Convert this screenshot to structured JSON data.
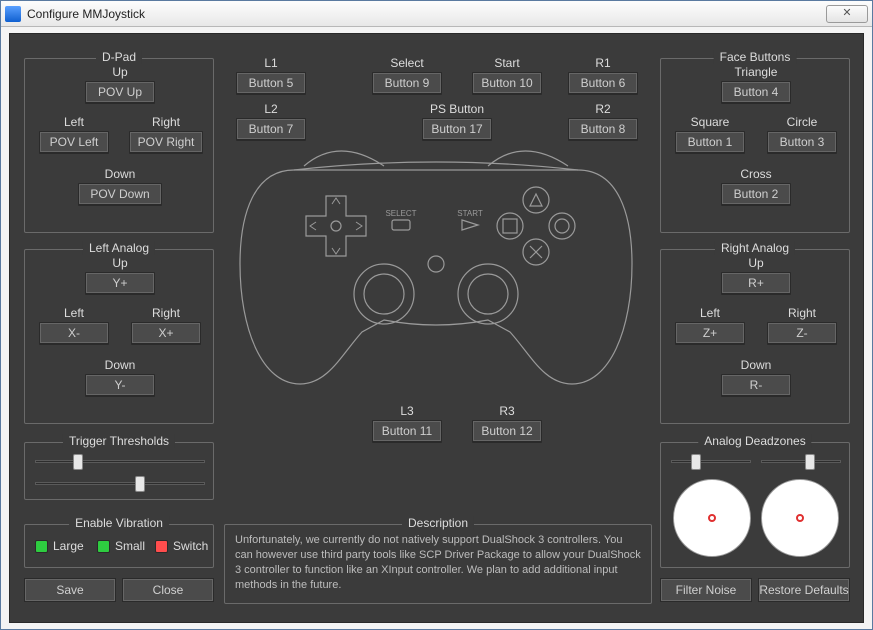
{
  "window": {
    "title": "Configure MMJoystick"
  },
  "top": {
    "l1": {
      "label": "L1",
      "value": "Button 5"
    },
    "l2": {
      "label": "L2",
      "value": "Button 7"
    },
    "select": {
      "label": "Select",
      "value": "Button 9"
    },
    "start": {
      "label": "Start",
      "value": "Button 10"
    },
    "ps": {
      "label": "PS Button",
      "value": "Button 17"
    },
    "r1": {
      "label": "R1",
      "value": "Button 6"
    },
    "r2": {
      "label": "R2",
      "value": "Button 8"
    },
    "l3": {
      "label": "L3",
      "value": "Button 11"
    },
    "r3": {
      "label": "R3",
      "value": "Button 12"
    }
  },
  "dpad": {
    "legend": "D-Pad",
    "up": {
      "label": "Up",
      "value": "POV Up"
    },
    "down": {
      "label": "Down",
      "value": "POV Down"
    },
    "left": {
      "label": "Left",
      "value": "POV Left"
    },
    "right": {
      "label": "Right",
      "value": "POV Right"
    }
  },
  "face": {
    "legend": "Face Buttons",
    "triangle": {
      "label": "Triangle",
      "value": "Button 4"
    },
    "square": {
      "label": "Square",
      "value": "Button 1"
    },
    "circle": {
      "label": "Circle",
      "value": "Button 3"
    },
    "cross": {
      "label": "Cross",
      "value": "Button 2"
    }
  },
  "lanalog": {
    "legend": "Left Analog",
    "up": {
      "label": "Up",
      "value": "Y+"
    },
    "down": {
      "label": "Down",
      "value": "Y-"
    },
    "left": {
      "label": "Left",
      "value": "X-"
    },
    "right": {
      "label": "Right",
      "value": "X+"
    }
  },
  "ranalog": {
    "legend": "Right Analog",
    "up": {
      "label": "Up",
      "value": "R+"
    },
    "down": {
      "label": "Down",
      "value": "R-"
    },
    "left": {
      "label": "Left",
      "value": "Z+"
    },
    "right": {
      "label": "Right",
      "value": "Z-"
    }
  },
  "triggers": {
    "legend": "Trigger Thresholds"
  },
  "deadzones": {
    "legend": "Analog Deadzones"
  },
  "vibration": {
    "legend": "Enable Vibration",
    "large": "Large",
    "small": "Small",
    "switch": "Switch"
  },
  "description": {
    "legend": "Description",
    "text": "Unfortunately, we currently do not natively support DualShock 3 controllers. You can however use third party tools like SCP Driver Package to allow your DualShock 3 controller to function like an XInput controller. We plan to add additional input methods in the future."
  },
  "actions": {
    "save": "Save",
    "close": "Close",
    "filter": "Filter Noise",
    "restore": "Restore Defaults"
  }
}
